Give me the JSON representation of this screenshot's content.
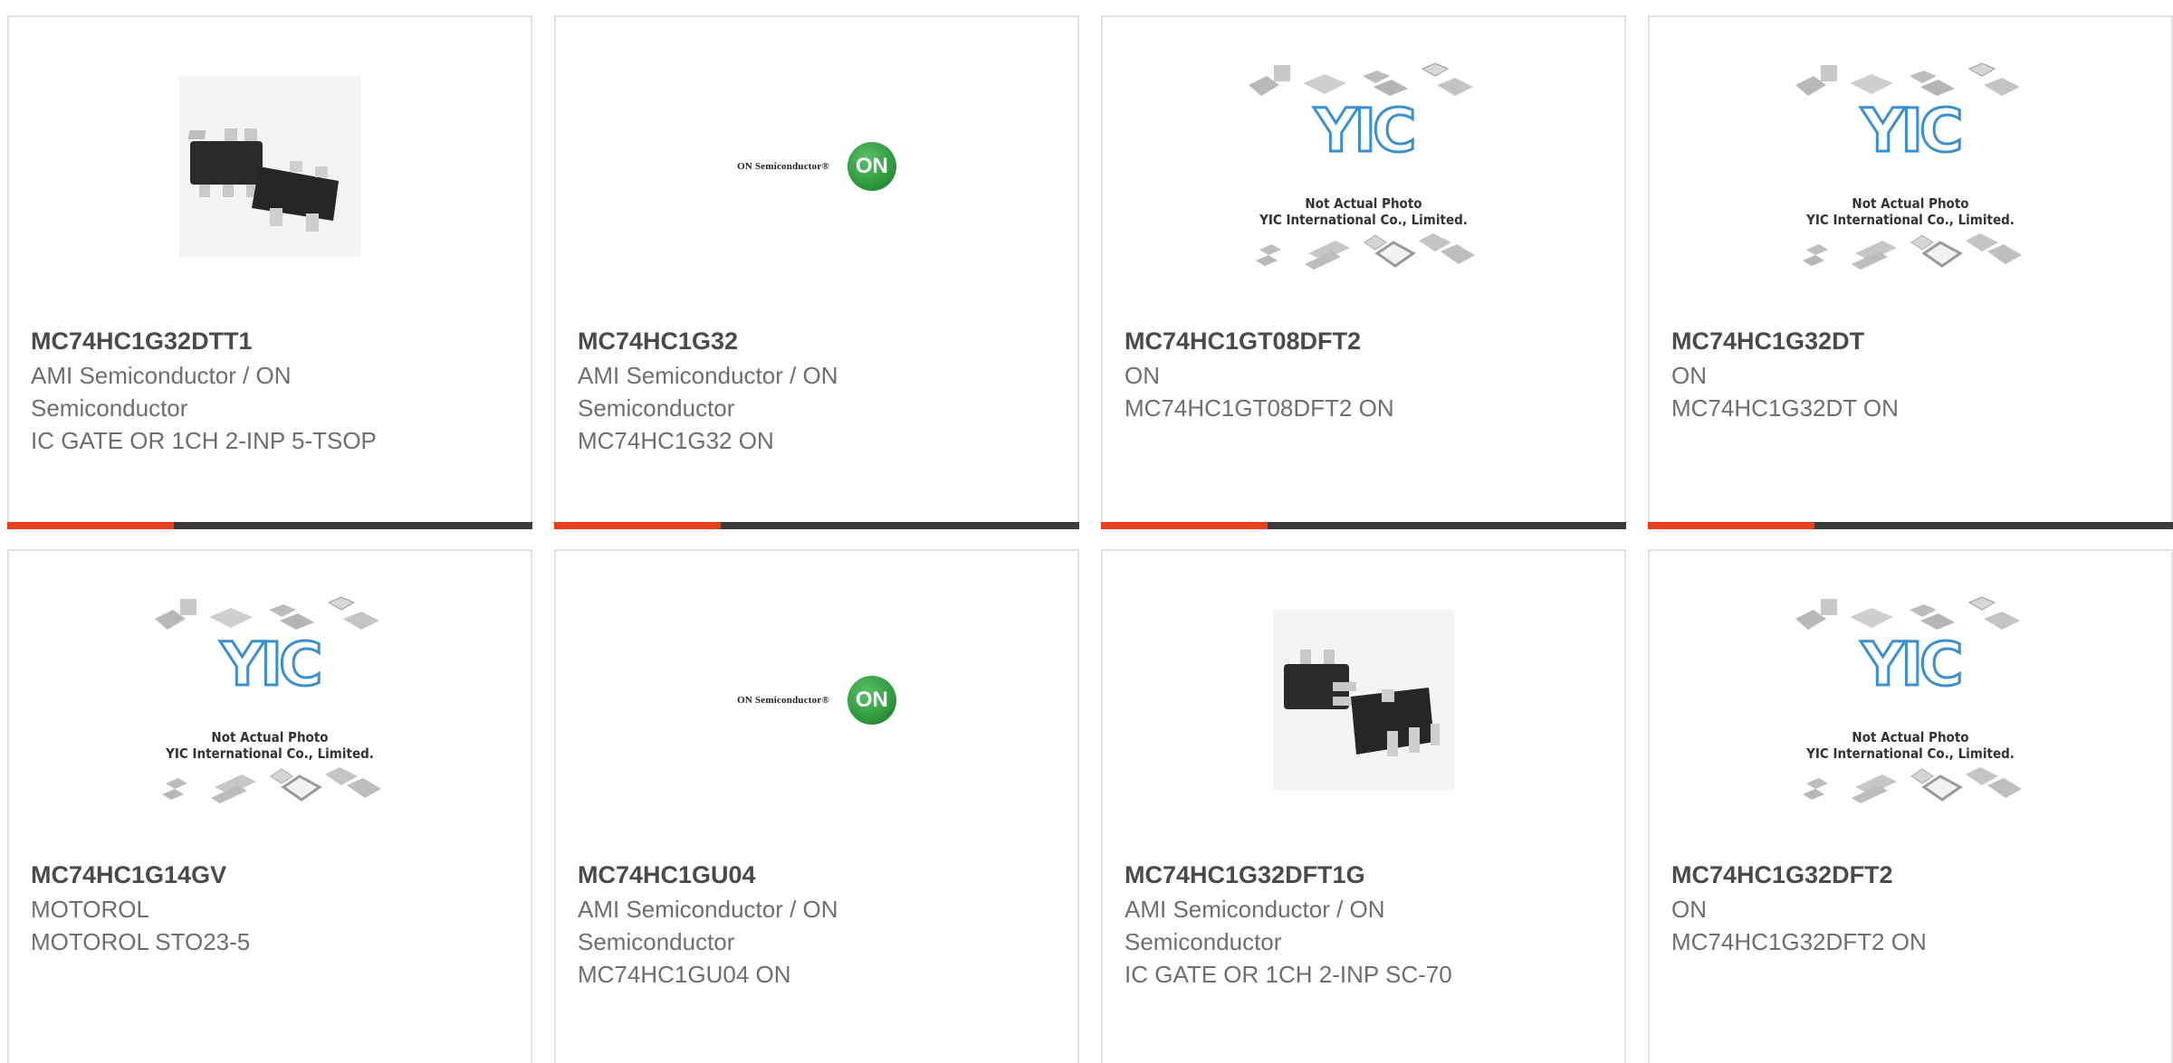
{
  "products": [
    {
      "part": "MC74HC1G32DTT1",
      "lines": [
        "AMI Semiconductor / ON",
        "Semiconductor",
        "IC GATE OR 1CH 2-INP 5-TSOP"
      ],
      "image": "tsop5-chip-photo",
      "accent": true
    },
    {
      "part": "MC74HC1G32",
      "lines": [
        "AMI Semiconductor / ON",
        "Semiconductor",
        "MC74HC1G32 ON"
      ],
      "image": "on-semiconductor-logo",
      "logo_text": "ON Semiconductor®",
      "logo_badge": "ON",
      "accent": true
    },
    {
      "part": "MC74HC1GT08DFT2",
      "lines": [
        "ON",
        "MC74HC1GT08DFT2 ON"
      ],
      "image": "yic-placeholder",
      "placeholder": {
        "brand": "YIC",
        "line1": "Not Actual Photo",
        "line2": "YIC International Co., Limited."
      },
      "accent": true
    },
    {
      "part": "MC74HC1G32DT",
      "lines": [
        "ON",
        "MC74HC1G32DT ON"
      ],
      "image": "yic-placeholder",
      "placeholder": {
        "brand": "YIC",
        "line1": "Not Actual Photo",
        "line2": "YIC International Co., Limited."
      },
      "accent": true
    },
    {
      "part": "MC74HC1G14GV",
      "lines": [
        "MOTOROL",
        "MOTOROL STO23-5"
      ],
      "image": "yic-placeholder",
      "placeholder": {
        "brand": "YIC",
        "line1": "Not Actual Photo",
        "line2": "YIC International Co., Limited."
      },
      "accent": false
    },
    {
      "part": "MC74HC1GU04",
      "lines": [
        "AMI Semiconductor / ON",
        "Semiconductor",
        "MC74HC1GU04 ON"
      ],
      "image": "on-semiconductor-logo",
      "logo_text": "ON Semiconductor®",
      "logo_badge": "ON",
      "accent": false
    },
    {
      "part": "MC74HC1G32DFT1G",
      "lines": [
        "AMI Semiconductor / ON",
        "Semiconductor",
        "IC GATE OR 1CH 2-INP SC-70"
      ],
      "image": "sc70-chip-photo",
      "accent": false
    },
    {
      "part": "MC74HC1G32DFT2",
      "lines": [
        "ON",
        "MC74HC1G32DFT2 ON"
      ],
      "image": "yic-placeholder",
      "placeholder": {
        "brand": "YIC",
        "line1": "Not Actual Photo",
        "line2": "YIC International Co., Limited."
      },
      "accent": false
    }
  ],
  "colors": {
    "accent": "#e8401c",
    "bar": "#3b3b3b",
    "border": "#e2e2e2",
    "text": "#6e6e6e",
    "title": "#4a4a4a",
    "on_green": "#2e9a3c",
    "yic_blue": "#3a8fd0"
  }
}
